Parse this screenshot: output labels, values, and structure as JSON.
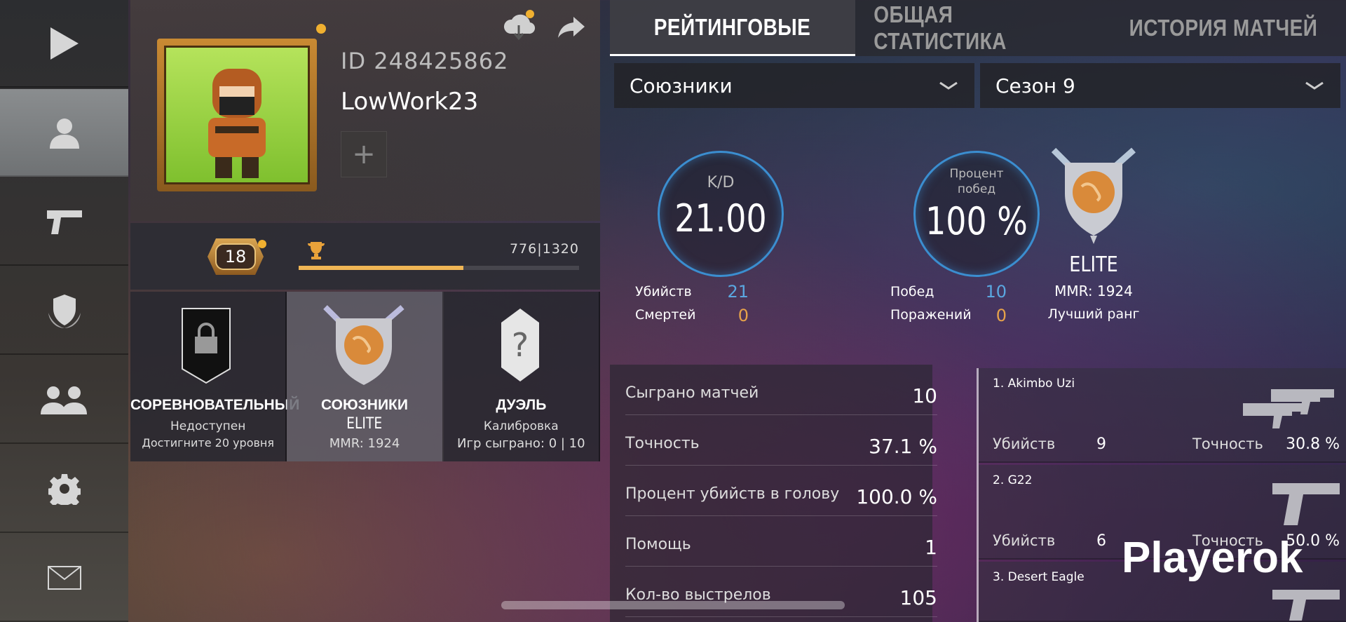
{
  "sidebar": {
    "items": [
      {
        "icon": "play-icon"
      },
      {
        "icon": "profile-icon",
        "active": true
      },
      {
        "icon": "pistol-icon"
      },
      {
        "icon": "shield-emblem-icon"
      },
      {
        "icon": "friends-icon"
      },
      {
        "icon": "gear-icon"
      },
      {
        "icon": "mail-icon"
      }
    ]
  },
  "profile": {
    "id": "ID 248425862",
    "name": "LowWork23",
    "add_symbol": "+"
  },
  "level": {
    "value": "18",
    "xp_text": "776|1320",
    "xp_fraction": 0.588
  },
  "modes": [
    {
      "title": "СОРЕВНОВАТЕЛЬНЫЙ",
      "sub1": "Недоступен",
      "sub2": "Достигните 20 уровня"
    },
    {
      "title": "СОЮЗНИКИ",
      "rank": "ELITE",
      "sub2": "MMR: 1924"
    },
    {
      "title": "ДУЭЛЬ",
      "sub1": "Калибровка",
      "sub2": "Игр сыграно: 0 | 10"
    }
  ],
  "tabs": [
    "РЕЙТИНГОВЫЕ",
    "ОБЩАЯ СТАТИСТИКА",
    "ИСТОРИЯ МАТЧЕЙ"
  ],
  "filters": {
    "mode": "Союзники",
    "season": "Сезон 9"
  },
  "summary": {
    "kd_label": "K/D",
    "kd_value": "21.00",
    "winrate_label_1": "Процент",
    "winrate_label_2": "побед",
    "winrate_value": "100 %",
    "kills_label": "Убийств",
    "kills_value": "21",
    "deaths_label": "Смертей",
    "deaths_value": "0",
    "wins_label": "Побед",
    "wins_value": "10",
    "losses_label": "Поражений",
    "losses_value": "0"
  },
  "rank": {
    "name": "ELITE",
    "mmr": "MMR: 1924",
    "best": "Лучший ранг"
  },
  "stats": [
    {
      "label": "Сыграно матчей",
      "value": "10"
    },
    {
      "label": "Точность",
      "value": "37.1 %"
    },
    {
      "label": "Процент убийств в голову",
      "value": "100.0 %"
    },
    {
      "label": "Помощь",
      "value": "1"
    },
    {
      "label": "Кол-во выстрелов",
      "value": "105"
    }
  ],
  "weapons": [
    {
      "name": "1. Akimbo Uzi",
      "kills_label": "Убийств",
      "kills": "9",
      "acc_label": "Точность",
      "acc": "30.8 %"
    },
    {
      "name": "2. G22",
      "kills_label": "Убийств",
      "kills": "6",
      "acc_label": "Точность",
      "acc": "50.0 %"
    },
    {
      "name": "3. Desert Eagle"
    }
  ],
  "watermark": "Playerok",
  "colors": {
    "accent_orange": "#f0b030",
    "kd_ring": "#3b8ed0",
    "stat_blue": "#5aa7e0",
    "stat_orange": "#e6a24a"
  }
}
